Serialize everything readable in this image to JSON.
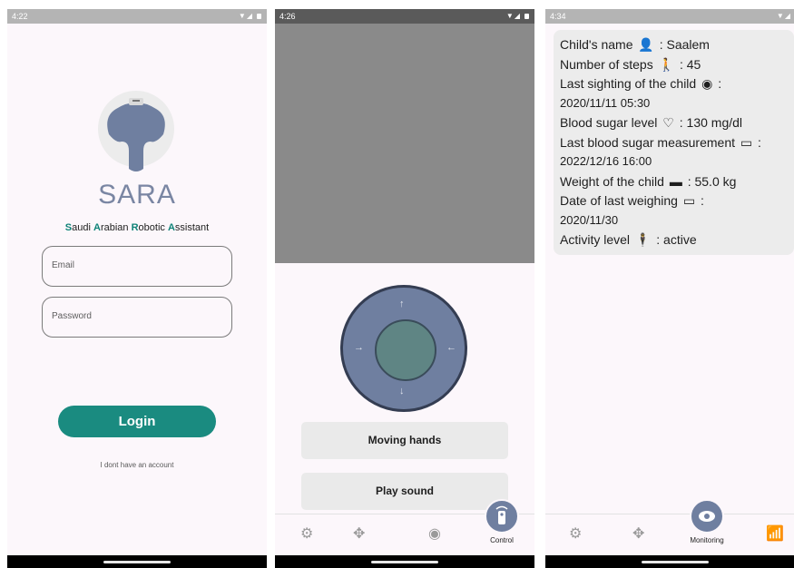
{
  "screens": {
    "login": {
      "status_time": "4:22",
      "brand": "SARA",
      "tagline": [
        {
          "b": "S",
          "t": "audi "
        },
        {
          "b": "A",
          "t": "rabian "
        },
        {
          "b": "R",
          "t": "obotic "
        },
        {
          "b": "A",
          "t": "ssistant"
        }
      ],
      "email_placeholder": "Email",
      "password_placeholder": "Password",
      "login_label": "Login",
      "no_account_link": "I dont have an account"
    },
    "control": {
      "status_time": "4:26",
      "moving_hands_label": "Moving hands",
      "play_sound_label": "Play sound",
      "nav_active_label": "Control"
    },
    "monitoring": {
      "status_time": "4:34",
      "lines": {
        "name": "Child's name",
        "name_value": ": Saalem",
        "steps": "Number of steps",
        "steps_value": ": 45",
        "sighting": "Last sighting of the child",
        "sighting_suffix": ":",
        "sighting_value": "2020/11/11  05:30",
        "sugar": "Blood sugar level",
        "sugar_value": ":  130 mg/dl",
        "sugar_meas": "Last blood sugar measurement",
        "sugar_meas_suffix": ":",
        "sugar_meas_value": "2022/12/16  16:00",
        "weight": "Weight of the child",
        "weight_value": ": 55.0 kg",
        "weigh_date": "Date of last weighing",
        "weigh_date_suffix": ":",
        "weigh_date_value": "2020/11/30",
        "activity": "Activity level",
        "activity_value": ": active"
      },
      "nav_active_label": "Monitoring"
    }
  },
  "icons": {
    "settings": "gear-icon",
    "gamepad": "gamepad-icon",
    "eye": "eye-icon",
    "remote": "remote-icon"
  },
  "colors": {
    "accent": "#1a8b80",
    "robot": "#6f7fa0"
  }
}
